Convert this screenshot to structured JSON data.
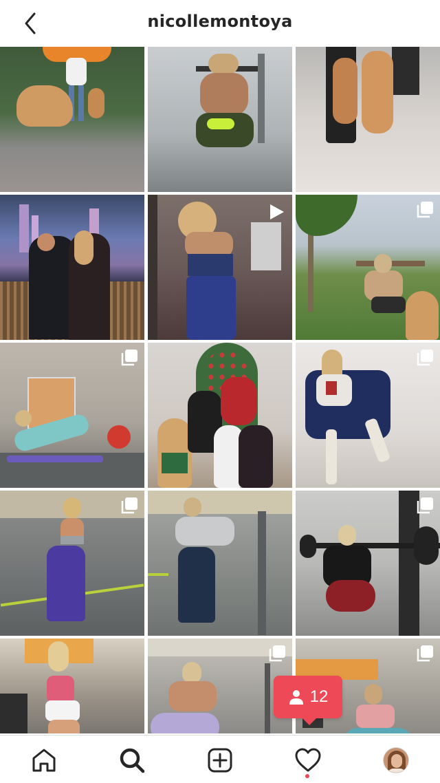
{
  "header": {
    "username": "nicollemontoya",
    "back_icon": "chevron-left-icon"
  },
  "posts": [
    {
      "id": 1,
      "type": "photo",
      "scene": "dogs-outdoor"
    },
    {
      "id": 2,
      "type": "photo",
      "scene": "gym-back"
    },
    {
      "id": 3,
      "type": "photo",
      "scene": "puppies"
    },
    {
      "id": 4,
      "type": "photo",
      "scene": "city-night"
    },
    {
      "id": 5,
      "type": "video",
      "scene": "gym-mirror-blue"
    },
    {
      "id": 6,
      "type": "carousel",
      "scene": "outdoor-workout"
    },
    {
      "id": 7,
      "type": "carousel",
      "scene": "gym-mat"
    },
    {
      "id": 8,
      "type": "photo",
      "scene": "christmas-family"
    },
    {
      "id": 9,
      "type": "carousel",
      "scene": "chair-selfie"
    },
    {
      "id": 10,
      "type": "carousel",
      "scene": "gym-mirror-purple"
    },
    {
      "id": 11,
      "type": "photo",
      "scene": "gym-mirror-grey"
    },
    {
      "id": 12,
      "type": "carousel",
      "scene": "squat-rack"
    },
    {
      "id": 13,
      "type": "photo",
      "scene": "gym-selfie-pink"
    },
    {
      "id": 14,
      "type": "carousel",
      "scene": "gym-squat-mask"
    },
    {
      "id": 15,
      "type": "carousel",
      "scene": "deadlift"
    }
  ],
  "notification": {
    "icon": "person-icon",
    "count": "12"
  },
  "bottom_nav": {
    "items": [
      "home-icon",
      "search-icon",
      "new-post-icon",
      "activity-heart-icon",
      "profile-avatar"
    ],
    "active": "search-icon"
  },
  "colors": {
    "notification_badge": "#ed4956",
    "border": "#dbdbdb",
    "text": "#262626"
  }
}
